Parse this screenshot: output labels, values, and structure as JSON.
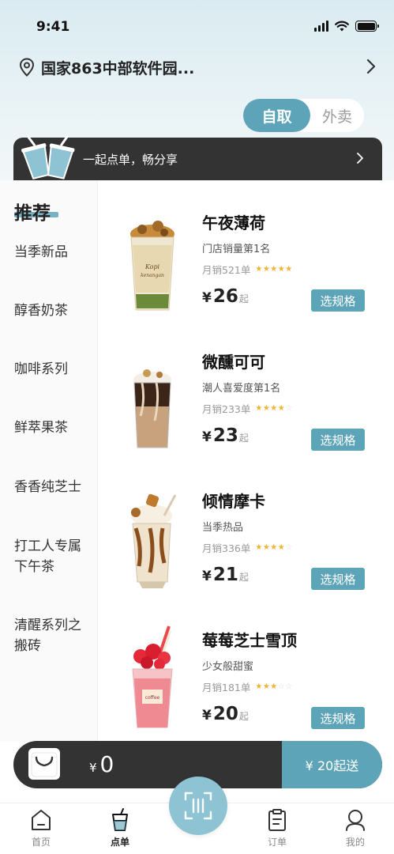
{
  "status_bar": {
    "time": "9:41"
  },
  "location": {
    "text": "国家863中部软件园..."
  },
  "mode_toggle": {
    "active": "自取",
    "inactive": "外卖"
  },
  "promo": {
    "text": "一起点单，畅分享"
  },
  "sidebar": {
    "title": "推荐",
    "items": [
      {
        "label": "当季新品"
      },
      {
        "label": "醇香奶茶"
      },
      {
        "label": "咖啡系列"
      },
      {
        "label": "鲜萃果茶"
      },
      {
        "label": "香香纯芝士"
      },
      {
        "label": "打工人专属下午茶"
      },
      {
        "label": "清醒系列之搬砖"
      }
    ]
  },
  "products": [
    {
      "name": "午夜薄荷",
      "subtitle": "门店销量第1名",
      "sales": "月销521单",
      "rating": 5,
      "price_symbol": "¥",
      "price": "26",
      "price_suffix": "起",
      "button": "选规格",
      "icon": "iced-coffee-cup-icon"
    },
    {
      "name": "微醺可可",
      "subtitle": "潮人喜爱度第1名",
      "sales": "月销233单",
      "rating": 4,
      "price_symbol": "¥",
      "price": "23",
      "price_suffix": "起",
      "button": "选规格",
      "icon": "layered-cocoa-cup-icon"
    },
    {
      "name": "倾情摩卡",
      "subtitle": "当季热品",
      "sales": "月销336单",
      "rating": 4,
      "price_symbol": "¥",
      "price": "21",
      "price_suffix": "起",
      "button": "选规格",
      "icon": "mocha-cup-icon"
    },
    {
      "name": "莓莓芝士雪顶",
      "subtitle": "少女般甜蜜",
      "sales": "月销181单",
      "rating": 3,
      "price_symbol": "¥",
      "price": "20",
      "price_suffix": "起",
      "button": "选规格",
      "icon": "strawberry-cheese-cup-icon"
    }
  ],
  "cart": {
    "symbol": "¥",
    "amount": "0",
    "delivery": "¥ 20起送"
  },
  "tab_bar": {
    "items": [
      {
        "label": "首页",
        "icon": "home-icon"
      },
      {
        "label": "点单",
        "icon": "cup-icon",
        "active": true
      },
      {
        "label": "订单",
        "icon": "order-list-icon"
      },
      {
        "label": "我的",
        "icon": "user-icon"
      }
    ],
    "center_icon": "scan-icon"
  },
  "colors": {
    "accent": "#5ea4b8",
    "accent_light": "#8ec3d3",
    "dark": "#333333",
    "star": "#f2b233"
  }
}
